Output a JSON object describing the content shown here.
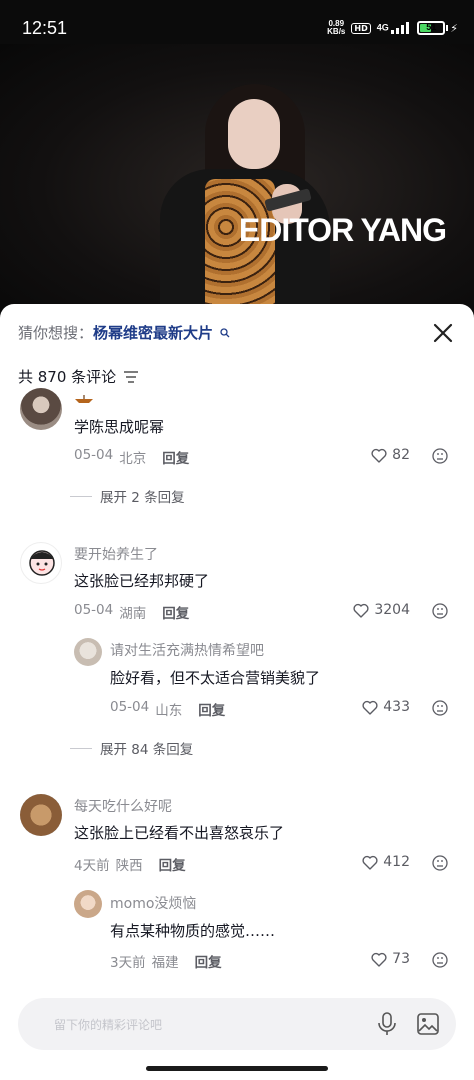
{
  "status_bar": {
    "time": "12:51",
    "net_speed_value": "0.89",
    "net_speed_unit": "KB/s",
    "hd_label": "HD",
    "signal_label": "4G",
    "battery_level": "51"
  },
  "video": {
    "watermark": "EDITOR YANG"
  },
  "comments_panel": {
    "suggest_prefix": "猜你想搜：",
    "suggest_query": "杨幂维密最新大片",
    "count_label": "共 870 条评论",
    "input_placeholder": "留下你的精彩评论吧"
  },
  "comments": [
    {
      "name": "",
      "text": "学陈思成呢幂",
      "date": "05-04",
      "location": "北京",
      "reply_label": "回复",
      "likes": "82",
      "expand_label": "展开 2 条回复"
    },
    {
      "name": "要开始养生了",
      "text": "这张脸已经邦邦硬了",
      "date": "05-04",
      "location": "湖南",
      "reply_label": "回复",
      "likes": "3204",
      "replies": [
        {
          "name": "请对生活充满热情希望吧",
          "text": "脸好看，但不太适合营销美貌了",
          "date": "05-04",
          "location": "山东",
          "reply_label": "回复",
          "likes": "433"
        }
      ],
      "expand_label": "展开 84 条回复"
    },
    {
      "name": "每天吃什么好呢",
      "text": "这张脸上已经看不出喜怒哀乐了",
      "date": "4天前",
      "location": "陕西",
      "reply_label": "回复",
      "likes": "412",
      "replies": [
        {
          "name": "momo没烦恼",
          "text": "有点某种物质的感觉……",
          "date": "3天前",
          "location": "福建",
          "reply_label": "回复",
          "likes": "73"
        }
      ]
    }
  ]
}
